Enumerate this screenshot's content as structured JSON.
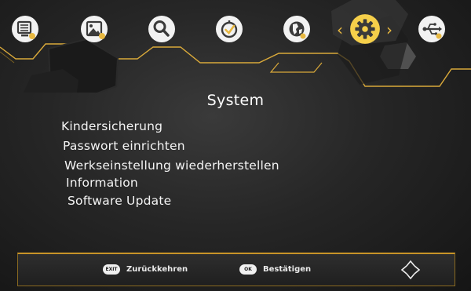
{
  "top_menu": {
    "items": [
      {
        "id": "tv",
        "icon": "tv-list-icon",
        "selected": false
      },
      {
        "id": "media",
        "icon": "picture-icon",
        "selected": false
      },
      {
        "id": "search",
        "icon": "search-icon",
        "selected": false
      },
      {
        "id": "timer",
        "icon": "clock-check-icon",
        "selected": false
      },
      {
        "id": "network",
        "icon": "globe-icon",
        "selected": false
      },
      {
        "id": "system",
        "icon": "gear-icon",
        "selected": true
      },
      {
        "id": "usb",
        "icon": "usb-icon",
        "selected": false
      }
    ],
    "left_arrow": "‹",
    "right_arrow": "›"
  },
  "page": {
    "title": "System"
  },
  "menu": {
    "items": [
      {
        "label": "Kindersicherung"
      },
      {
        "label": "Passwort einrichten"
      },
      {
        "label": "Werkseinstellung wiederherstellen"
      },
      {
        "label": "Information"
      },
      {
        "label": "Software Update"
      }
    ]
  },
  "footer": {
    "back": {
      "key": "EXIT",
      "label": "Zurückkehren"
    },
    "confirm": {
      "key": "OK",
      "label": "Bestätigen"
    },
    "dpad_icon": "navigation-arrows-icon"
  },
  "colors": {
    "accent": "#e8b840",
    "icon_bg": "#f2f2f2",
    "icon_fg": "#3a3a3a",
    "background": "#262626"
  }
}
